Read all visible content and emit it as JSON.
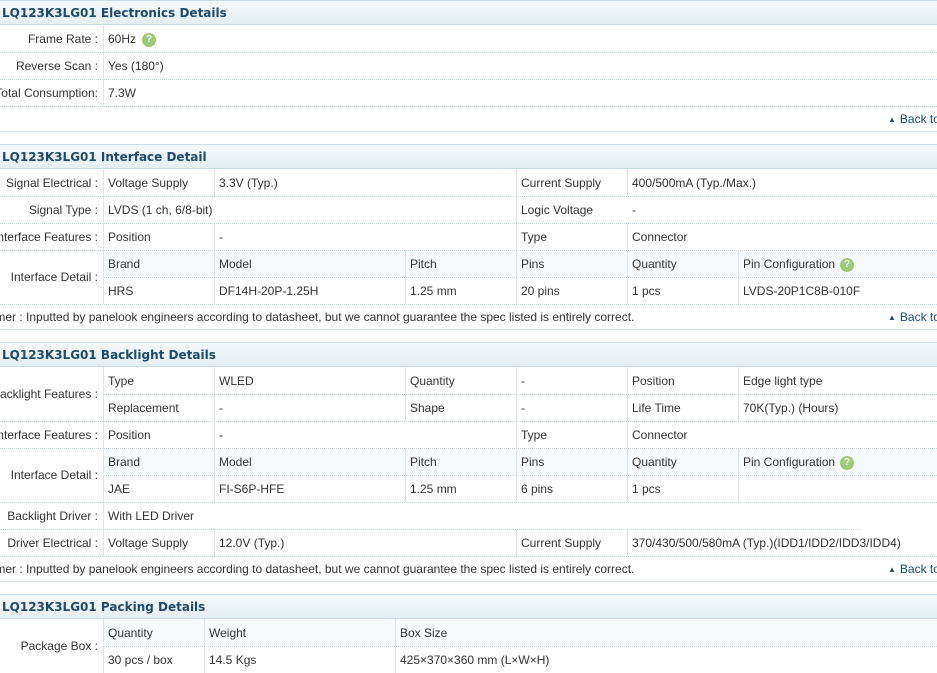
{
  "electronics": {
    "header": "LQ123K3LG01 Electronics Details",
    "frame_rate_label": "Frame Rate :",
    "frame_rate_value": "60Hz",
    "reverse_scan_label": "Reverse Scan :",
    "reverse_scan_value": "Yes (180°)",
    "total_consumption_label": "Total Consumption:",
    "total_consumption_value": "7.3W"
  },
  "back_to_top": "Back to Top",
  "help_glyph": "?",
  "disclaimer": "Disclaimer : Inputted by panelook engineers according to datasheet, but we cannot guarantee the spec listed is entirely correct.",
  "interface": {
    "header": "LQ123K3LG01 Interface Detail",
    "signal_electrical_label": "Signal Electrical :",
    "voltage_supply_label": "Voltage Supply",
    "voltage_supply_value": "3.3V (Typ.)",
    "current_supply_label": "Current Supply",
    "current_supply_value": "400/500mA (Typ./Max.)",
    "signal_type_label": "Signal Type :",
    "signal_type_value": "LVDS (1 ch, 6/8-bit)",
    "logic_voltage_label": "Logic Voltage",
    "logic_voltage_value": "-",
    "interface_features_label": "Interface Features :",
    "position_label": "Position",
    "position_value": "-",
    "type_label": "Type",
    "type_value": "Connector",
    "interface_detail_label": "Interface Detail :",
    "cols": [
      "Brand",
      "Model",
      "Pitch",
      "Pins",
      "Quantity",
      "Pin Configuration"
    ],
    "row": [
      "HRS",
      "DF14H-20P-1.25H",
      "1.25 mm",
      "20 pins",
      "1 pcs",
      "LVDS-20P1C8B-010F"
    ]
  },
  "backlight": {
    "header": "LQ123K3LG01 Backlight Details",
    "features_label": "Backlight Features :",
    "type_label": "Type",
    "type_value": "WLED",
    "quantity_label": "Quantity",
    "quantity_value": "-",
    "position_label": "Position",
    "position_value": "Edge light type",
    "replacement_label": "Replacement",
    "replacement_value": "-",
    "shape_label": "Shape",
    "shape_value": "-",
    "life_time_label": "Life Time",
    "life_time_value": "70K(Typ.) (Hours)",
    "interface_features_label": "Interface Features :",
    "if_position_label": "Position",
    "if_position_value": "-",
    "if_type_label": "Type",
    "if_type_value": "Connector",
    "interface_detail_label": "Interface Detail :",
    "cols": [
      "Brand",
      "Model",
      "Pitch",
      "Pins",
      "Quantity",
      "Pin Configuration"
    ],
    "row": [
      "JAE",
      "FI-S6P-HFE",
      "1.25 mm",
      "6 pins",
      "1 pcs",
      ""
    ],
    "driver_label": "Backlight Driver :",
    "driver_value": "With LED Driver",
    "driver_electrical_label": "Driver Electrical :",
    "voltage_supply_label": "Voltage Supply",
    "voltage_supply_value": "12.0V (Typ.)",
    "current_supply_label": "Current Supply",
    "current_supply_value": "370/430/500/580mA (Typ.)(IDD1/IDD2/IDD3/IDD4)"
  },
  "packing": {
    "header": "LQ123K3LG01 Packing Details",
    "package_box_label": "Package Box :",
    "cols": [
      "Quantity",
      "Weight",
      "Box Size"
    ],
    "row": [
      "30 pcs / box",
      "14.5 Kgs",
      "425×370×360 mm (L×W×H)"
    ]
  }
}
